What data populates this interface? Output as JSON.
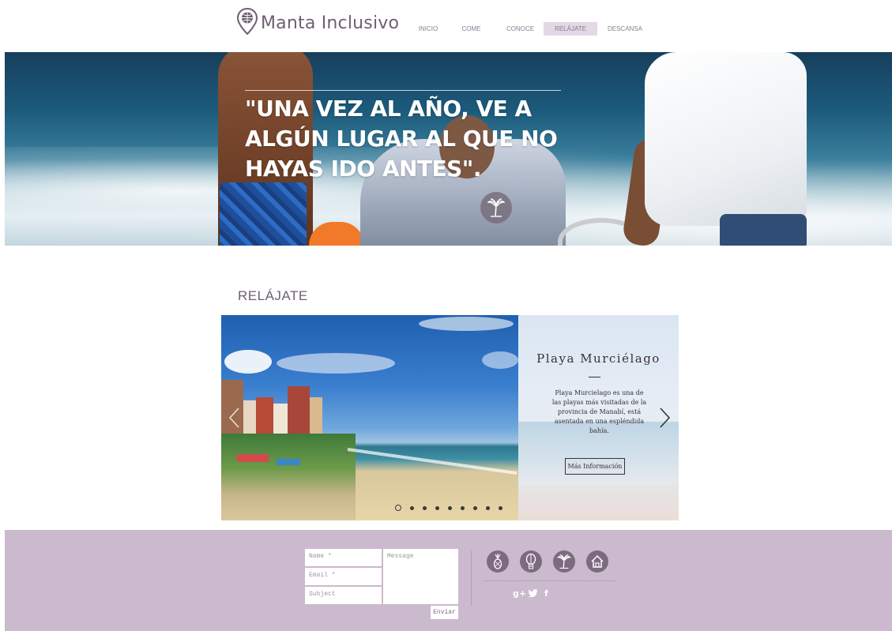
{
  "header": {
    "logo_text": "Manta Inclusivo",
    "nav": [
      {
        "label": "INICIO"
      },
      {
        "label": "COME"
      },
      {
        "label": "CONOCE"
      },
      {
        "label": "RELÁJATE",
        "active": true
      },
      {
        "label": "DESCANSA"
      }
    ]
  },
  "hero": {
    "quote": "\"UNA VEZ AL AÑO, VE A ALGÚN LUGAR AL QUE NO HAYAS IDO ANTES\".",
    "badge_icon": "palm-tree-icon"
  },
  "section": {
    "title": "RELÁJATE"
  },
  "slider": {
    "title": "Playa Murciélago",
    "description": "Playa Murcielago es una de las playas más visitadas de la provincia de Manabí, está asentada en una espléndida bahía.",
    "button_label": "Más Información",
    "slide_count": 9,
    "active_slide": 1
  },
  "footer": {
    "form": {
      "name_placeholder": "Name *",
      "email_placeholder": "Email *",
      "subject_placeholder": "Subject",
      "message_placeholder": "Message",
      "send_label": "Enviar"
    },
    "icons": [
      "pineapple-icon",
      "hot-air-balloon-icon",
      "palm-tree-icon",
      "home-icon"
    ],
    "social": {
      "google_plus": "g+",
      "twitter": "twitter-icon",
      "facebook": "f"
    }
  },
  "colors": {
    "accent": "#cbb9cd",
    "icon_fill": "#7d6a80",
    "nav_active_bg": "#e3d8e6",
    "text": "#6e5f73"
  }
}
